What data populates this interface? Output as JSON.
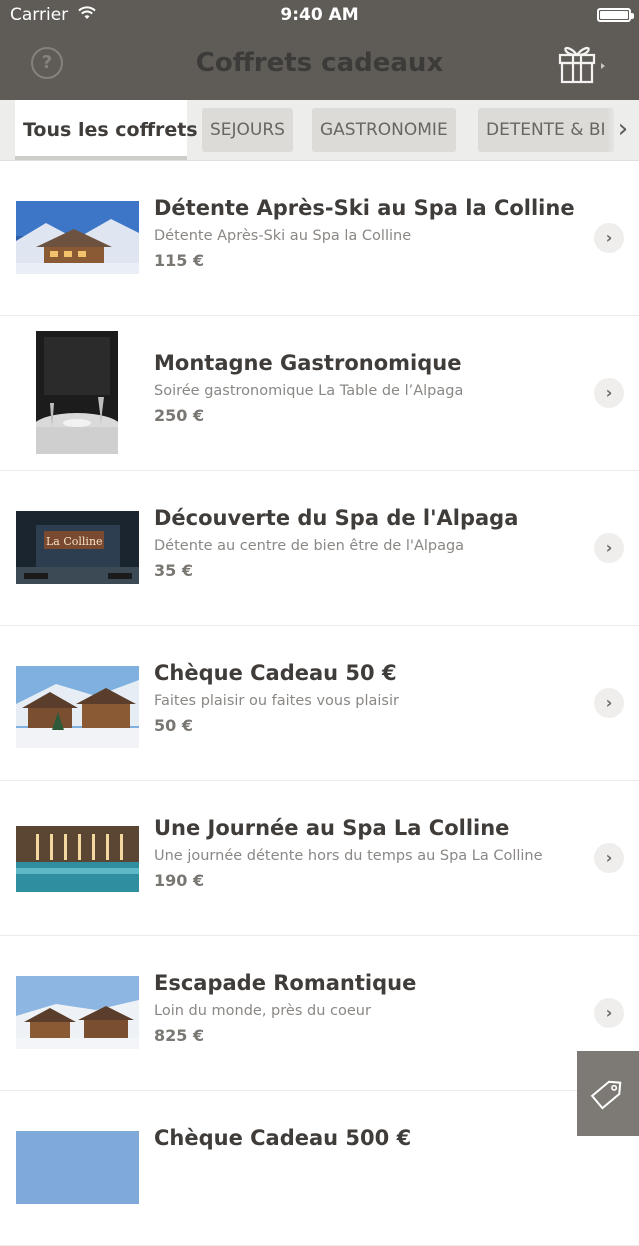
{
  "status": {
    "carrier": "Carrier",
    "time": "9:40 AM"
  },
  "nav": {
    "title": "Coffrets cadeaux",
    "help_label": "?"
  },
  "tabs": [
    {
      "label": "Tous les coffrets"
    },
    {
      "label": "SEJOURS"
    },
    {
      "label": "GASTRONOMIE"
    },
    {
      "label": "DETENTE & BI"
    }
  ],
  "list": [
    {
      "title": "Détente Après-Ski au Spa la Colline",
      "subtitle": "Détente Après-Ski au Spa la Colline",
      "price": "115 €"
    },
    {
      "title": "Montagne Gastronomique",
      "subtitle": "Soirée gastronomique La Table de l’Alpaga",
      "price": "250 €"
    },
    {
      "title": "Découverte du Spa de l'Alpaga",
      "subtitle": "Détente au centre de bien être de l'Alpaga",
      "price": "35 €",
      "image_text": "La Colline"
    },
    {
      "title": "Chèque Cadeau 50 €",
      "subtitle": "Faites plaisir ou faites vous plaisir",
      "price": "50 €"
    },
    {
      "title": "Une Journée au Spa La Colline",
      "subtitle": "Une journée détente hors du temps au Spa La Colline",
      "price": "190 €"
    },
    {
      "title": "Escapade Romantique",
      "subtitle": "Loin du monde, près du coeur",
      "price": "825 €"
    },
    {
      "title": "Chèque Cadeau 500 €",
      "subtitle": "",
      "price": ""
    }
  ],
  "colors": {
    "header": "#5f5c58",
    "tabs_bg": "#ededec",
    "accent": "#3f3c3a"
  }
}
